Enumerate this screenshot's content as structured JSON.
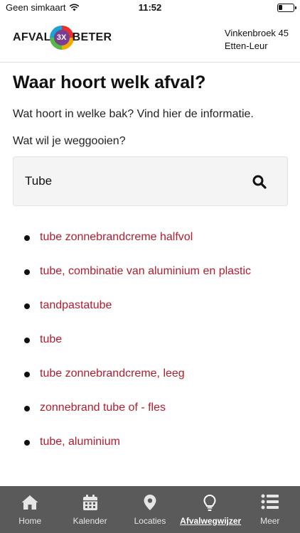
{
  "status": {
    "carrier": "Geen simkaart",
    "time": "11:52"
  },
  "header": {
    "logo": {
      "left": "AFVAL",
      "badge": "3X",
      "right": "BETER"
    },
    "address_line1": "Vinkenbroek 45",
    "address_line2": "Etten-Leur"
  },
  "main": {
    "title": "Waar hoort welk afval?",
    "intro": "Wat hoort in welke bak? Vind hier de informatie.",
    "question": "Wat wil je weggooien?",
    "search": {
      "value": "Tube"
    },
    "results": [
      "tube zonnebrandcreme halfvol",
      "tube, combinatie van aluminium en plastic",
      "tandpastatube",
      "tube",
      "tube zonnebrandcreme, leeg",
      "zonnebrand tube of - fles",
      "tube, aluminium"
    ]
  },
  "tabbar": {
    "tabs": [
      {
        "label": "Home",
        "icon": "home-icon"
      },
      {
        "label": "Kalender",
        "icon": "calendar-icon"
      },
      {
        "label": "Locaties",
        "icon": "map-pin-icon"
      },
      {
        "label": "Afvalwegwijzer",
        "icon": "lightbulb-icon",
        "active": true
      },
      {
        "label": "Meer",
        "icon": "list-icon"
      }
    ]
  },
  "colors": {
    "link": "#b01e2d",
    "tabbar": "#5a5a5a"
  }
}
